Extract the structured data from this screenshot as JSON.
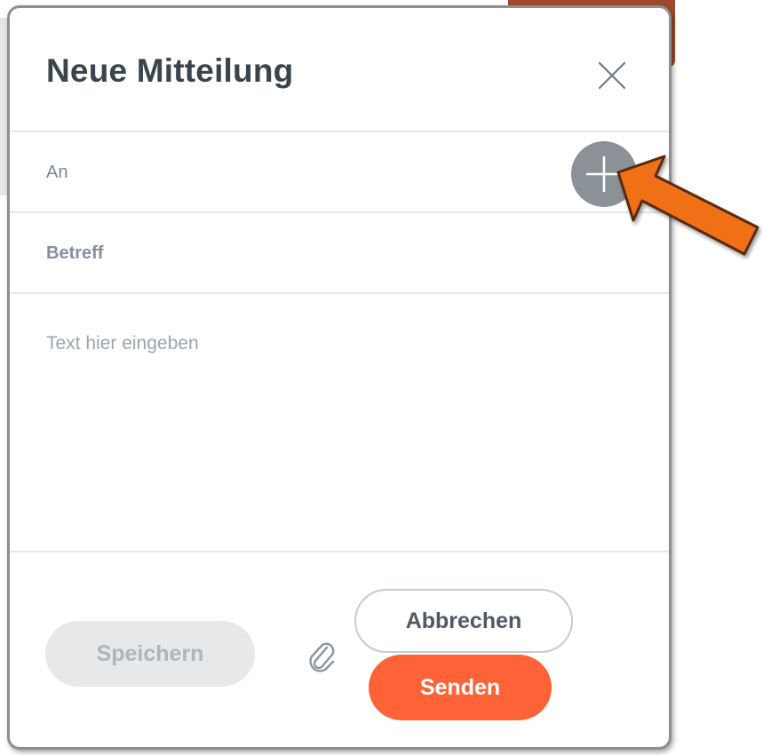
{
  "dialog": {
    "title": "Neue Mitteilung",
    "close_icon": "close-icon"
  },
  "fields": {
    "to_label": "An",
    "add_recipient_icon": "plus-icon",
    "subject_label": "Betreff",
    "body_placeholder": "Text hier eingeben"
  },
  "actions": {
    "save_label": "Speichern",
    "attach_icon": "paperclip-icon",
    "cancel_label": "Abbrechen",
    "send_label": "Senden"
  },
  "annotation": {
    "arrow_color": "#f07018",
    "points_to": "add-recipient-button"
  },
  "colors": {
    "send": "#fd6336",
    "save_disabled": "#e6e8ea",
    "add_button": "#8a9297",
    "title": "#3a444c"
  }
}
